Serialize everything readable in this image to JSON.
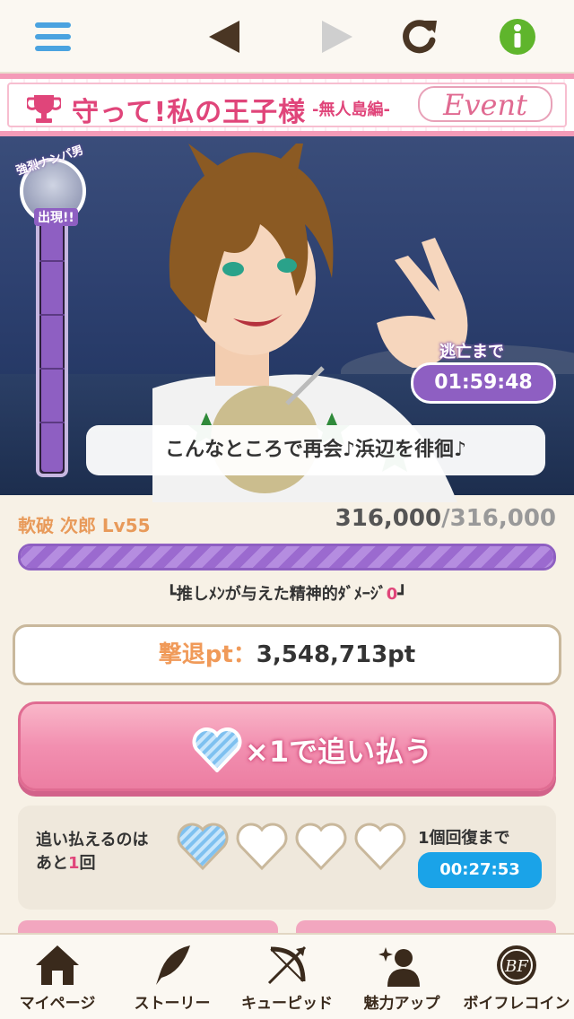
{
  "topnav": {
    "menu_icon": "hamburger-menu-icon",
    "back_icon": "back-arrow-icon",
    "forward_icon": "forward-arrow-icon",
    "reload_icon": "reload-icon",
    "info_icon": "info-icon"
  },
  "banner": {
    "title": "守って!私の王子様",
    "subtitle": "-無人島編-",
    "event_label": "Event",
    "icon": "trophy-icon"
  },
  "scene": {
    "rival_tag": "強烈ナンパ男",
    "appear_label": "出現!!",
    "escape_label": "逃亡まで",
    "escape_timer": "01:59:48",
    "speech": "こんなところで再会♪浜辺を徘徊♪"
  },
  "enemy": {
    "name": "軟破 次郎 Lv55",
    "hp_current": "316,000",
    "hp_separator": "/",
    "hp_max": "316,000",
    "hp_fraction": 1.0,
    "damage_prefix": "┗推しﾒﾝが与えた精神的ﾀﾞﾒｰｼﾞ",
    "damage_value": "0",
    "damage_suffix": "┛"
  },
  "points": {
    "label": "撃退pt：",
    "value": "3,548,713pt"
  },
  "chase_button": {
    "label": "×1で追い払う"
  },
  "chase_panel": {
    "line1": "追い払えるのは",
    "line2_prefix": "あと",
    "line2_count": "1",
    "line2_suffix": "回",
    "hearts": [
      "filled",
      "empty",
      "empty",
      "empty"
    ],
    "recover_label": "1個回復まで",
    "recover_timer": "00:27:53"
  },
  "bottomnav": {
    "items": [
      {
        "label": "マイページ",
        "icon": "house-icon"
      },
      {
        "label": "ストーリー",
        "icon": "quill-icon"
      },
      {
        "label": "キューピッド",
        "icon": "bow-arrow-icon"
      },
      {
        "label": "魅力アップ",
        "icon": "person-sparkle-icon"
      },
      {
        "label": "ボイフレコイン",
        "icon": "coin-icon"
      }
    ]
  },
  "colors": {
    "accent_pink": "#e0457a",
    "accent_purple": "#8e5fc2",
    "accent_orange": "#f09a59",
    "accent_blue": "#1aa3e8"
  }
}
